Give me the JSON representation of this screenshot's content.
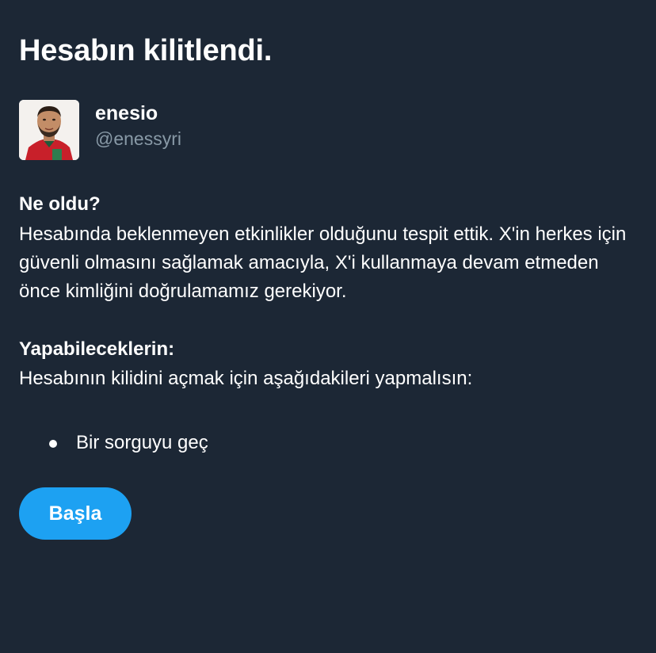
{
  "title": "Hesabın kilitlendi.",
  "account": {
    "display_name": "enesio",
    "handle": "@enessyri",
    "avatar_icon": "user-avatar-photo"
  },
  "what_happened": {
    "heading": "Ne oldu?",
    "text": "Hesabında beklenmeyen etkinlikler olduğunu tespit ettik. X'in herkes için güvenli olmasını sağlamak amacıyla, X'i kullanmaya devam etmeden önce kimliğini doğrulamamız gerekiyor."
  },
  "what_you_can_do": {
    "heading": "Yapabileceklerin:",
    "text": "Hesabının kilidini açmak için aşağıdakileri yapmalısın:",
    "steps": [
      {
        "label": "Bir sorguyu geç"
      }
    ]
  },
  "start_button": {
    "label": "Başla"
  },
  "colors": {
    "background": "#1c2735",
    "text": "#ffffff",
    "secondary_text": "#8899a6",
    "accent": "#1da1f2"
  }
}
